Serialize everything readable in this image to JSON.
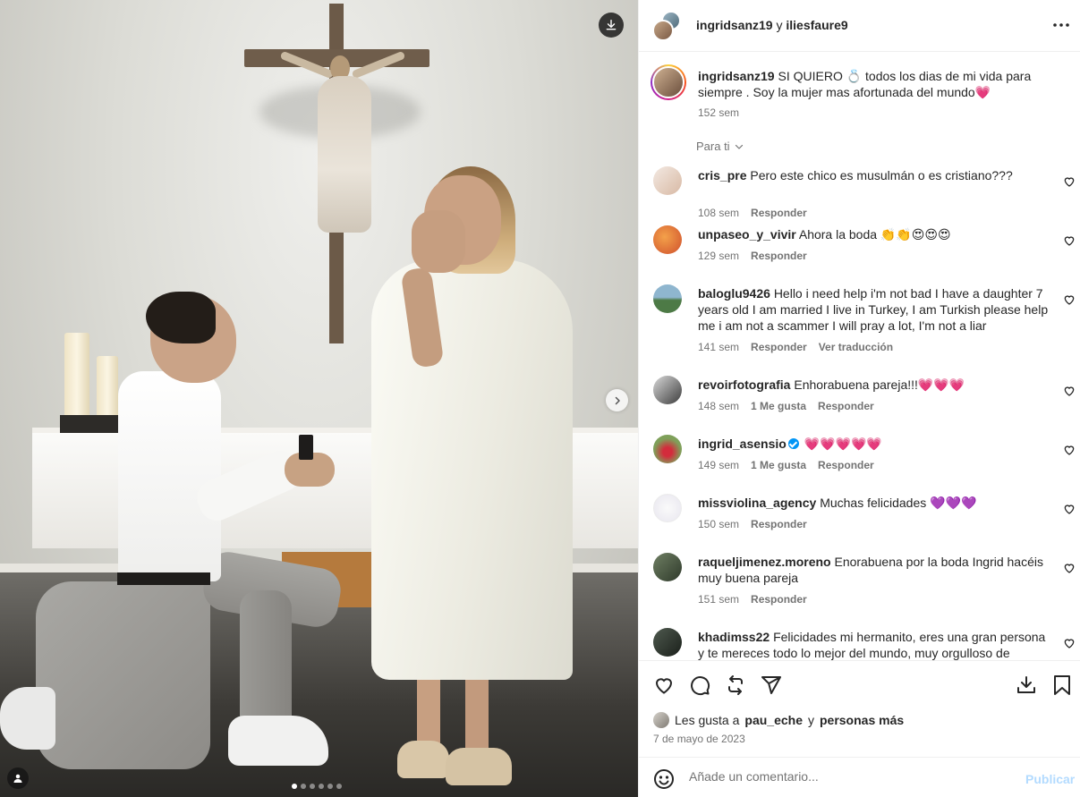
{
  "header": {
    "author": "ingridsanz19",
    "connector": "y",
    "coauthor": "iliesfaure9",
    "more_icon": "more-horizontal-icon"
  },
  "media": {
    "download_icon": "download-icon",
    "next_icon": "chevron-right-icon",
    "tag_icon": "user-tag-icon",
    "carousel_total": 6,
    "carousel_active": 1
  },
  "caption": {
    "username": "ingridsanz19",
    "text": "SI QUIERO 💍 todos los dias de mi vida para siempre . Soy la mujer mas afortunada del mundo💗",
    "time": "152 sem"
  },
  "filter": {
    "label": "Para ti"
  },
  "comments": [
    {
      "username": "cris_pre",
      "text": "Pero este chico es musulmán o es cristiano???",
      "time": "108 sem",
      "likes": "",
      "reply": "Responder",
      "translate": ""
    },
    {
      "username": "unpaseo_y_vivir",
      "text": "Ahora la boda 👏👏😍😍😍",
      "time": "129 sem",
      "likes": "",
      "reply": "Responder",
      "translate": ""
    },
    {
      "username": "baloglu9426",
      "text": "Hello i need help i'm not bad I have a daughter 7 years old I am married I live in Turkey, I am Turkish please help me i am not a scammer I will pray a lot, I'm not a liar",
      "time": "141 sem",
      "likes": "",
      "reply": "Responder",
      "translate": "Ver traducción"
    },
    {
      "username": "revoirfotografia",
      "text": "Enhorabuena pareja!!!💗💗💗",
      "time": "148 sem",
      "likes": "1 Me gusta",
      "reply": "Responder",
      "translate": ""
    },
    {
      "username": "ingrid_asensio",
      "text": "💗💗💗💗💗",
      "time": "149 sem",
      "likes": "1 Me gusta",
      "reply": "Responder",
      "translate": ""
    },
    {
      "username": "missviolina_agency",
      "text": "Muchas felicidades 💜💜💜",
      "time": "150 sem",
      "likes": "",
      "reply": "Responder",
      "translate": ""
    },
    {
      "username": "raqueljimenez.moreno",
      "text": "Enorabuena por la boda Ingrid hacéis muy buena pareja",
      "time": "151 sem",
      "likes": "",
      "reply": "Responder",
      "translate": ""
    },
    {
      "username": "khadimss22",
      "text": "Felicidades mi hermanito, eres una gran persona y te mereces todo lo mejor del mundo, muy orgulloso de",
      "time": "",
      "likes": "",
      "reply": "",
      "translate": ""
    }
  ],
  "actions": {
    "like_icon": "heart-icon",
    "comment_icon": "comment-icon",
    "repost_icon": "repost-icon",
    "share_icon": "share-icon",
    "save_icon": "bookmark-icon",
    "download_icon": "download-tray-icon"
  },
  "likes": {
    "prefix": "Les gusta a",
    "user": "pau_eche",
    "connector": "y",
    "others": "personas más"
  },
  "date": "7 de mayo de 2023",
  "composer": {
    "placeholder": "Añade un comentario...",
    "publish": "Publicar",
    "emoji_icon": "emoji-icon"
  },
  "colors": {
    "text": "#262626",
    "secondary": "#737373",
    "border": "#efefef",
    "publish_disabled": "#b3dbff",
    "verified": "#0095f6",
    "heart": "#e2264d"
  }
}
